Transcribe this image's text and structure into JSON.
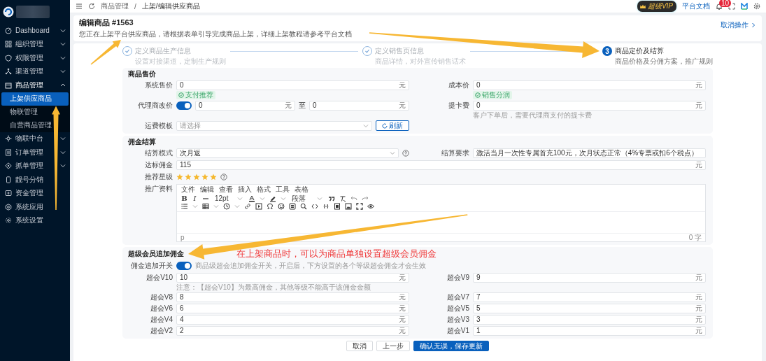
{
  "sidebar": {
    "items": [
      {
        "label": "Dashboard",
        "expanded": false
      },
      {
        "label": "组织管理",
        "expanded": false
      },
      {
        "label": "权限管理",
        "expanded": false
      },
      {
        "label": "渠道管理",
        "expanded": false
      },
      {
        "label": "商品管理",
        "expanded": true,
        "children": [
          {
            "label": "上架供应商品",
            "selected": true
          },
          {
            "label": "物联管理",
            "selected": false
          },
          {
            "label": "自营商品管理",
            "selected": false
          }
        ]
      },
      {
        "label": "物联中台",
        "expanded": false
      },
      {
        "label": "订单管理",
        "expanded": false
      },
      {
        "label": "抓单管理",
        "expanded": false
      },
      {
        "label": "靓号分销"
      },
      {
        "label": "资金管理"
      },
      {
        "label": "系统应用"
      },
      {
        "label": "系统设置"
      }
    ]
  },
  "topbar": {
    "breadcrumb": [
      "商品管理",
      "上架/编辑供应商品"
    ],
    "separator": "/",
    "vip_badge": "超级VIP",
    "docs_link": "平台文档",
    "notification_count": "10"
  },
  "header": {
    "title": "编辑商品 #1563",
    "description": "您正在上架平台供应商品，请根据表单引导完成商品上架，详细上架教程请参考平台文档",
    "cancel": "取消操作"
  },
  "steps": [
    {
      "title": "定义商品生产信息",
      "subtitle": "设置对接渠道，定制生产规则",
      "done": true
    },
    {
      "title": "定义销售页信息",
      "subtitle": "商品详情，对外宣传销售话术",
      "done": true
    },
    {
      "number": "3",
      "title": "商品定价及结算",
      "subtitle": "商品价格及分佣方案，推广规则",
      "done": false
    }
  ],
  "pricing": {
    "title": "商品售价",
    "system_price": {
      "label": "系统售价",
      "value": "0",
      "unit": "元",
      "tag": "支付推荐"
    },
    "cost_price": {
      "label": "成本价",
      "value": "0",
      "unit": "元",
      "tag": "销售分润"
    },
    "agent_price": {
      "label": "代理商改价",
      "on": true,
      "min": "0",
      "min_unit": "元",
      "to": "至",
      "max": "0",
      "max_unit": "元"
    },
    "card_fee": {
      "label": "提卡费",
      "value": "0",
      "unit": "元",
      "hint": "客户下单后，需要代理商支付的提卡费"
    },
    "shipping": {
      "label": "运费模板",
      "placeholder": "请选择",
      "button": "刷新"
    }
  },
  "commission": {
    "title": "佣金结算",
    "mode": {
      "label": "结算模式",
      "value": "次月返"
    },
    "requirement": {
      "label": "结算要求",
      "value": "激活当月一次性专属首充100元，次月状态正常（4%专票或扣6个税点）"
    },
    "reward": {
      "label": "达标佣金",
      "value": "115",
      "unit": "元"
    },
    "rating": {
      "label": "推荐星级",
      "stars": 5
    },
    "material": {
      "label": "推广资料",
      "menu": [
        "文件",
        "编辑",
        "查看",
        "插入",
        "格式",
        "工具",
        "表格"
      ],
      "bold": "B",
      "italic": "I",
      "font_size": "12pt",
      "block": "段落",
      "path": "p",
      "word_count": "0 字"
    }
  },
  "super_member": {
    "title": "超级会员追加佣金",
    "annotation": "在上架商品时，可以为商品单独设置超级会员佣金",
    "switch": {
      "label": "佣金追加开关",
      "on": true,
      "hint": "商品级超会追加佣金开关，开启后，下方设置的各个等级超会佣金才会生效"
    },
    "levels": [
      {
        "label": "超会V10",
        "value": "10",
        "unit": "元",
        "note": "注意：【超会V10】为最高佣金，其他等级不能高于该佣金金额"
      },
      {
        "label": "超会V9",
        "value": "9",
        "unit": "元"
      },
      {
        "label": "超会V8",
        "value": "8",
        "unit": "元"
      },
      {
        "label": "超会V7",
        "value": "7",
        "unit": "元"
      },
      {
        "label": "超会V6",
        "value": "6",
        "unit": "元"
      },
      {
        "label": "超会V5",
        "value": "5",
        "unit": "元"
      },
      {
        "label": "超会V4",
        "value": "4",
        "unit": "元"
      },
      {
        "label": "超会V3",
        "value": "3",
        "unit": "元"
      },
      {
        "label": "超会V2",
        "value": "2",
        "unit": "元"
      },
      {
        "label": "超会V1",
        "value": "1",
        "unit": "元"
      }
    ]
  },
  "actions": [
    {
      "label": "取消",
      "kind": "default"
    },
    {
      "label": "上一步",
      "kind": "default"
    },
    {
      "label": "确认无误，保存更新",
      "kind": "primary"
    }
  ]
}
